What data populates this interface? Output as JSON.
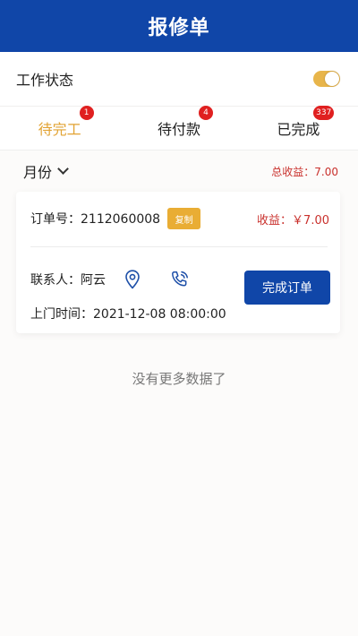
{
  "header": {
    "title": "报修单"
  },
  "work_status": {
    "label": "工作状态",
    "toggle_on": true,
    "toggle_color": "#e8b54a"
  },
  "tabs": [
    {
      "label": "待完工",
      "badge": "1",
      "active": true
    },
    {
      "label": "待付款",
      "badge": "4",
      "active": false
    },
    {
      "label": "已完成",
      "badge": "337",
      "active": false
    }
  ],
  "filter": {
    "month_label": "月份",
    "total_income": "总收益：7.00"
  },
  "order": {
    "order_no": "订单号：2112060008",
    "copy_label": "复制",
    "income": "收益：￥7.00",
    "contact": "联系人：阿云",
    "visit_time": "上门时间：2021-12-08 08:00:00",
    "complete_label": "完成订单"
  },
  "no_more": "没有更多数据了",
  "colors": {
    "primary": "#1046a8",
    "accent": "#e2a333",
    "danger": "#c9302c",
    "badge": "#e02020"
  },
  "icons": {
    "location": "location-pin-icon",
    "phone": "phone-call-icon",
    "month": "chevron-down-icon"
  }
}
